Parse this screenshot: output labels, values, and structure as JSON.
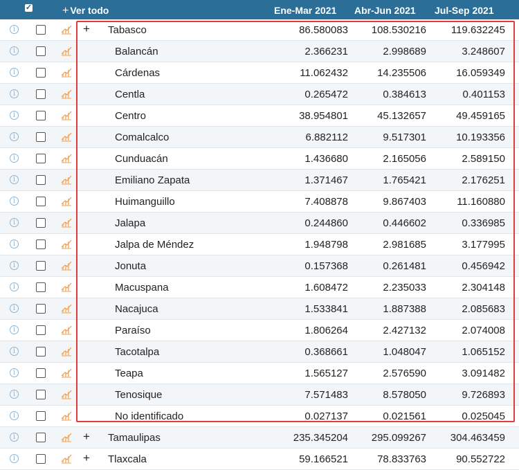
{
  "header": {
    "ver_todo": "Ver todo",
    "plus_glyph": "+",
    "columns": [
      "Ene-Mar 2021",
      "Abr-Jun 2021",
      "Jul-Sep 2021"
    ]
  },
  "colors": {
    "header_bg": "#2b6f98",
    "highlight_border": "#e03a3a",
    "alt_row": "#f3f6f8",
    "chart_icon": "#f29c4b"
  },
  "rows": [
    {
      "name": "Tabasco",
      "level": 0,
      "expand": "+",
      "values": [
        "86.580083",
        "108.530216",
        "119.632245"
      ]
    },
    {
      "name": "Balancán",
      "level": 1,
      "expand": "",
      "values": [
        "2.366231",
        "2.998689",
        "3.248607"
      ]
    },
    {
      "name": "Cárdenas",
      "level": 1,
      "expand": "",
      "values": [
        "11.062432",
        "14.235506",
        "16.059349"
      ]
    },
    {
      "name": "Centla",
      "level": 1,
      "expand": "",
      "values": [
        "0.265472",
        "0.384613",
        "0.401153"
      ]
    },
    {
      "name": "Centro",
      "level": 1,
      "expand": "",
      "values": [
        "38.954801",
        "45.132657",
        "49.459165"
      ]
    },
    {
      "name": "Comalcalco",
      "level": 1,
      "expand": "",
      "values": [
        "6.882112",
        "9.517301",
        "10.193356"
      ]
    },
    {
      "name": "Cunduacán",
      "level": 1,
      "expand": "",
      "values": [
        "1.436680",
        "2.165056",
        "2.589150"
      ]
    },
    {
      "name": "Emiliano Zapata",
      "level": 1,
      "expand": "",
      "values": [
        "1.371467",
        "1.765421",
        "2.176251"
      ]
    },
    {
      "name": "Huimanguillo",
      "level": 1,
      "expand": "",
      "values": [
        "7.408878",
        "9.867403",
        "11.160880"
      ]
    },
    {
      "name": "Jalapa",
      "level": 1,
      "expand": "",
      "values": [
        "0.244860",
        "0.446602",
        "0.336985"
      ]
    },
    {
      "name": "Jalpa de Méndez",
      "level": 1,
      "expand": "",
      "values": [
        "1.948798",
        "2.981685",
        "3.177995"
      ]
    },
    {
      "name": "Jonuta",
      "level": 1,
      "expand": "",
      "values": [
        "0.157368",
        "0.261481",
        "0.456942"
      ]
    },
    {
      "name": "Macuspana",
      "level": 1,
      "expand": "",
      "values": [
        "1.608472",
        "2.235033",
        "2.304148"
      ]
    },
    {
      "name": "Nacajuca",
      "level": 1,
      "expand": "",
      "values": [
        "1.533841",
        "1.887388",
        "2.085683"
      ]
    },
    {
      "name": "Paraíso",
      "level": 1,
      "expand": "",
      "values": [
        "1.806264",
        "2.427132",
        "2.074008"
      ]
    },
    {
      "name": "Tacotalpa",
      "level": 1,
      "expand": "",
      "values": [
        "0.368661",
        "1.048047",
        "1.065152"
      ]
    },
    {
      "name": "Teapa",
      "level": 1,
      "expand": "",
      "values": [
        "1.565127",
        "2.576590",
        "3.091482"
      ]
    },
    {
      "name": "Tenosique",
      "level": 1,
      "expand": "",
      "values": [
        "7.571483",
        "8.578050",
        "9.726893"
      ]
    },
    {
      "name": "No identificado",
      "level": 1,
      "expand": "",
      "values": [
        "0.027137",
        "0.021561",
        "0.025045"
      ]
    },
    {
      "name": "Tamaulipas",
      "level": 0,
      "expand": "+",
      "values": [
        "235.345204",
        "295.099267",
        "304.463459"
      ]
    },
    {
      "name": "Tlaxcala",
      "level": 0,
      "expand": "+",
      "values": [
        "59.166521",
        "78.833763",
        "90.552722"
      ]
    }
  ]
}
